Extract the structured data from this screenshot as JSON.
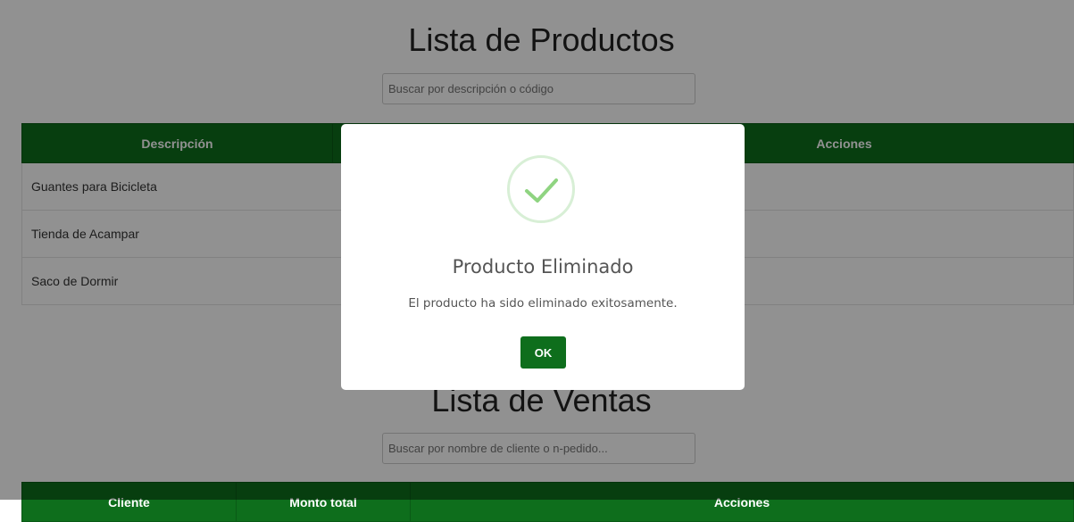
{
  "products_section": {
    "title": "Lista de Productos",
    "search_placeholder": "Buscar por descripción o código",
    "columns": [
      "Descripción",
      "",
      "",
      "Acciones"
    ],
    "rows": [
      "Guantes para Bicicleta",
      "Tienda de Acampar",
      "Saco de Dormir"
    ]
  },
  "sales_section": {
    "title": "Lista de Ventas",
    "search_placeholder": "Buscar por nombre de cliente o n-pedido...",
    "columns": [
      "Cliente",
      "Monto total",
      "Acciones"
    ]
  },
  "modal": {
    "icon": "success-check-icon",
    "title": "Producto Eliminado",
    "message": "El producto ha sido eliminado exitosamente.",
    "ok_label": "OK"
  },
  "colors": {
    "header_green": "#0e6e1c",
    "button_green": "#0e6e1c",
    "check_green": "#8fd481",
    "overlay": "rgba(0,0,0,0.43)"
  }
}
